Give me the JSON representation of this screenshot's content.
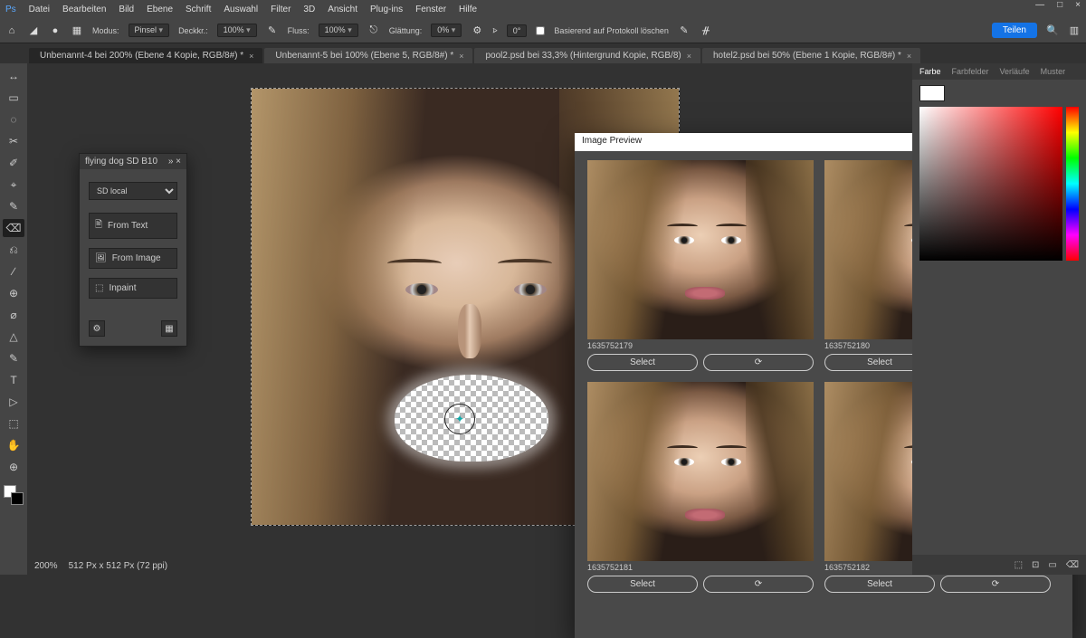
{
  "menu": [
    "Datei",
    "Bearbeiten",
    "Bild",
    "Ebene",
    "Schrift",
    "Auswahl",
    "Filter",
    "3D",
    "Ansicht",
    "Plug-ins",
    "Fenster",
    "Hilfe"
  ],
  "winctrl": {
    "min": "—",
    "max": "□",
    "close": "×"
  },
  "optbar": {
    "modus_lbl": "Modus:",
    "modus_val": "Pinsel",
    "deck_lbl": "Deckkr.:",
    "deck_val": "100%",
    "fluss_lbl": "Fluss:",
    "fluss_val": "100%",
    "glatt_lbl": "Glättung:",
    "glatt_val": "0%",
    "angle_lbl": "⦠",
    "angle_val": "0°",
    "archive_lbl": "Basierend auf Protokoll löschen",
    "share": "Teilen"
  },
  "tabs": [
    {
      "label": "Unbenannt-4 bei 200% (Ebene 4 Kopie, RGB/8#) *",
      "active": true
    },
    {
      "label": "Unbenannt-5 bei 100% (Ebene 5, RGB/8#) *",
      "active": false
    },
    {
      "label": "pool2.psd bei 33,3% (Hintergrund Kopie, RGB/8)",
      "active": false
    },
    {
      "label": "hotel2.psd bei 50% (Ebene 1 Kopie, RGB/8#) *",
      "active": false
    }
  ],
  "tool_icons": [
    "↔",
    "▭",
    "◌",
    "✂",
    "✐",
    "⌖",
    "✎",
    "⌫",
    "⎌",
    "∕",
    "⊕",
    "⌀",
    "△",
    "✎",
    "T",
    "▷",
    "⬚",
    "✋",
    "⊕"
  ],
  "plugin": {
    "title": "flying dog SD B10",
    "dropdown": "SD local",
    "btns": [
      {
        "icon": "🖹",
        "label": "From Text"
      },
      {
        "icon": "🖼",
        "label": "From Image"
      },
      {
        "icon": "⬚",
        "label": "Inpaint"
      }
    ],
    "gear": "⚙",
    "grid": "▦"
  },
  "modal": {
    "title": "Image Preview",
    "close": "×",
    "cells": [
      {
        "id": "1635752179",
        "select": "Select",
        "redo": "⟳"
      },
      {
        "id": "1635752180",
        "select": "Select",
        "redo": "⟳"
      },
      {
        "id": "1635752181",
        "select": "Select",
        "redo": "⟳"
      },
      {
        "id": "1635752182",
        "select": "Select",
        "redo": "⟳"
      }
    ]
  },
  "rpanel": {
    "tabs": [
      "Farbe",
      "Farbfelder",
      "Verläufe",
      "Muster"
    ]
  },
  "status": {
    "zoom": "200%",
    "dims": "512 Px x 512 Px (72 ppi)"
  },
  "docstat": [
    "⬚",
    "⊡",
    "▭",
    "⌫"
  ]
}
